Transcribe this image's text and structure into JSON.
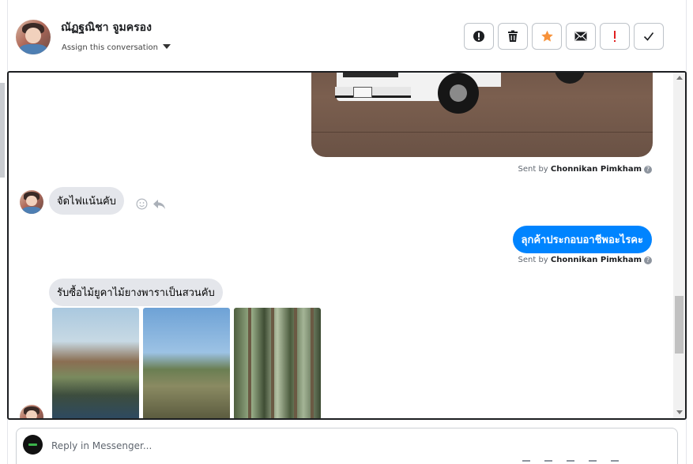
{
  "header": {
    "contact_name": "ณัฏฐณิชา จูมครอง",
    "assign_label": "Assign this conversation",
    "actions": [
      {
        "icon": "alert-circle-icon",
        "name": "mark-spam-button"
      },
      {
        "icon": "trash-icon",
        "name": "delete-button"
      },
      {
        "icon": "star-icon",
        "name": "star-button"
      },
      {
        "icon": "envelope-icon",
        "name": "mark-unread-button"
      },
      {
        "icon": "exclamation-icon",
        "name": "follow-up-button"
      },
      {
        "icon": "checkmark-icon",
        "name": "mark-done-button"
      }
    ]
  },
  "messages": [
    {
      "type": "image-outgoing",
      "sent_by_prefix": "Sent by",
      "sent_by_name": "Chonnikan Pimkham"
    },
    {
      "type": "incoming",
      "text": "จัดไฟแน้นคับ"
    },
    {
      "type": "outgoing",
      "text": "ลุกค้าประกอบอาชีพอะไรคะ",
      "sent_by_prefix": "Sent by",
      "sent_by_name": "Chonnikan Pimkham"
    },
    {
      "type": "incoming",
      "text": "รับซื้อไม้ยูคาไม้ยางพาราเป็นสวนคับ"
    }
  ],
  "composer": {
    "placeholder": "Reply in Messenger..."
  },
  "colors": {
    "outgoing_bubble": "#0084ff",
    "incoming_bubble": "#e4e6eb",
    "star": "#f7923a",
    "alert_red": "#e02020"
  }
}
